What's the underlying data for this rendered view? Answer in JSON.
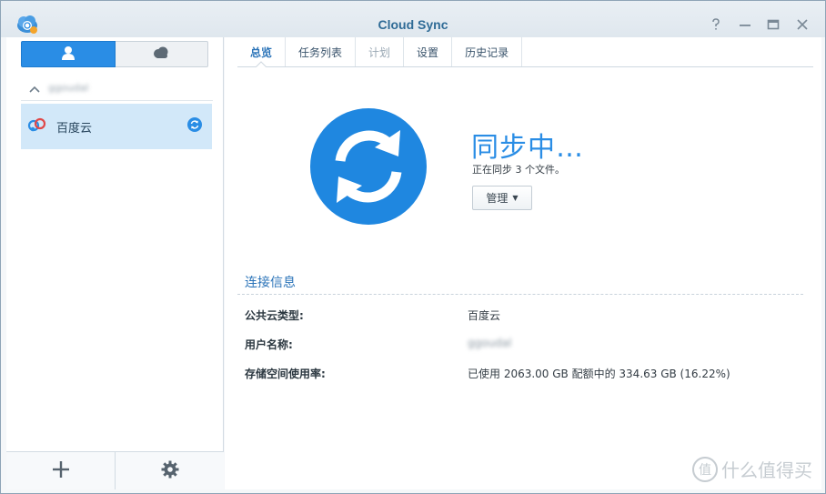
{
  "window": {
    "title": "Cloud Sync",
    "accent_color": "#2a8de5"
  },
  "icons": {
    "app": "cloud-sync-app-icon",
    "help": "help-icon",
    "minimize": "minimize-icon",
    "maximize": "maximize-icon",
    "close": "close-icon"
  },
  "sidebar": {
    "segments": [
      {
        "icon": "user-icon",
        "active": true
      },
      {
        "icon": "cloud-icon",
        "active": false
      }
    ],
    "account": {
      "name": "ggoudal"
    },
    "tasks": [
      {
        "label": "百度云",
        "icon": "baidu-cloud-icon",
        "status_icon": "syncing-icon"
      }
    ],
    "bottom_buttons": [
      {
        "icon": "add-icon"
      },
      {
        "icon": "settings-gear-icon"
      }
    ]
  },
  "tabs": [
    {
      "label": "总览",
      "active": true
    },
    {
      "label": "任务列表",
      "active": false
    },
    {
      "label": "计划",
      "active": false,
      "disabled": true
    },
    {
      "label": "设置",
      "active": false
    },
    {
      "label": "历史记录",
      "active": false
    }
  ],
  "overview": {
    "status_title": "同步中…",
    "status_subtitle": "正在同步 3 个文件。",
    "manage_button": "管理",
    "status_icon": "big-sync-icon"
  },
  "connection": {
    "section_title": "连接信息",
    "rows": [
      {
        "label": "公共云类型:",
        "value": "百度云",
        "blurred": false
      },
      {
        "label": "用户名称:",
        "value": "ggoudal",
        "blurred": true
      },
      {
        "label": "存储空间使用率:",
        "value": "已使用 2063.00 GB 配额中的 334.63 GB (16.22%)",
        "blurred": false
      }
    ]
  },
  "watermark": {
    "badge": "值",
    "text": "什么值得买"
  }
}
